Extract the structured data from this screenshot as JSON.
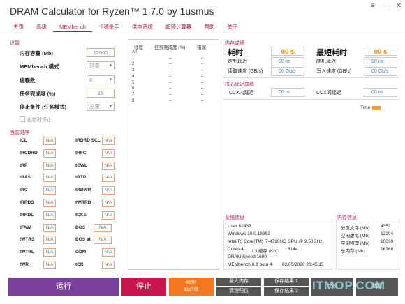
{
  "window": {
    "title": "DRAM Calculator for Ryzen™ 1.7.0 by 1usmus",
    "controls": [
      "≡",
      "—",
      "✕"
    ]
  },
  "tabs": [
    {
      "label": "主页",
      "active": false
    },
    {
      "label": "高级",
      "active": false
    },
    {
      "label": "MEMbench",
      "active": true
    },
    {
      "label": "卡顿杀手",
      "active": false
    },
    {
      "label": "供电系统",
      "active": false
    },
    {
      "label": "超频计算器",
      "active": false
    },
    {
      "label": "帮助",
      "active": false
    },
    {
      "label": "关于",
      "active": false
    }
  ],
  "settings": {
    "section_title": "设置",
    "memory_label": "内存容量 (Mb)",
    "memory_value": "12000",
    "mode_label": "MEMbench 模式",
    "mode_value": "轻量",
    "threads_label": "线程数",
    "threads_value": "8",
    "completion_label": "任务完成度 (%)",
    "completion_value": "15",
    "stop_label": "停止条件 (任务模式)",
    "stop_value": "总量",
    "stop_on_error_label": "出错时停止",
    "stop_on_error_checked": false
  },
  "timings": {
    "section_title": "当前时序",
    "left": [
      {
        "label": "tCL",
        "value": "N/A"
      },
      {
        "label": "tRCDRD",
        "value": "N/A"
      },
      {
        "label": "tRP",
        "value": "N/A"
      },
      {
        "label": "tRAS",
        "value": "N/A"
      },
      {
        "label": "tRC",
        "value": "N/A"
      },
      {
        "label": "tRRDS",
        "value": "N/A"
      },
      {
        "label": "tRRDL",
        "value": "N/A"
      },
      {
        "label": "tFAW",
        "value": "N/A"
      },
      {
        "label": "tWTRS",
        "value": "N/A"
      },
      {
        "label": "tWTRL",
        "value": "N/A"
      },
      {
        "label": "tWR",
        "value": "N/A"
      }
    ],
    "right": [
      {
        "label": "tRDRD SCL",
        "value": "N/A"
      },
      {
        "label": "tRFC",
        "value": "N/A"
      },
      {
        "label": "tCWL",
        "value": "N/A"
      },
      {
        "label": "tRTP",
        "value": "N/A"
      },
      {
        "label": "tRDWR",
        "value": "N/A"
      },
      {
        "label": "tWRRD",
        "value": "N/A"
      },
      {
        "label": "tCKE",
        "value": "N/A"
      },
      {
        "label": "BGS",
        "value": "N/A"
      },
      {
        "label": "BGS alt",
        "value": "N/A"
      },
      {
        "label": "GDM",
        "value": "N/A"
      },
      {
        "label": "tCR",
        "value": "N/A"
      }
    ]
  },
  "thread_table": {
    "headers": [
      "线程",
      "任务完成度 (%)",
      "错误"
    ],
    "rows": [
      [
        "All",
        "–",
        "–"
      ],
      [
        "1",
        "–",
        "–"
      ],
      [
        "2",
        "–",
        "–"
      ],
      [
        "3",
        "–",
        "–"
      ],
      [
        "4",
        "–",
        "–"
      ],
      [
        "5",
        "–",
        "–"
      ],
      [
        "6",
        "–",
        "–"
      ],
      [
        "7",
        "–",
        "–"
      ],
      [
        "8",
        "–",
        "–"
      ]
    ]
  },
  "results": {
    "section_title": "内存成绩",
    "elapsed_label": "耗时",
    "elapsed_value": "00 s",
    "fastest_label": "最短耗时",
    "fastest_value": "00 s",
    "seq_latency_label": "定制延迟",
    "seq_latency_value": "00 ns",
    "rand_latency_label": "随机延迟",
    "rand_latency_value": "00 ns",
    "read_label": "读取速度 (GB/s)",
    "read_value": "00 Gb/s",
    "write_label": "写入速度 (GB/s)",
    "write_value": "00 Gb/s"
  },
  "core_latency": {
    "section_title": "核心延迟成绩",
    "ccx_in_label": "CCX内延迟",
    "ccx_in_value": "00 ns",
    "ccx_between_label": "CCX间延迟",
    "ccx_between_value": "00 ns"
  },
  "time_legend": {
    "label": "Time",
    "color": "#f0a020"
  },
  "system_info": {
    "section_title": "系统信息",
    "user": "User 82439",
    "os": "Windows 10.0.18362",
    "cpu": "Intel(R) Core(TM) i7-4710HQ CPU @ 2.50GHz",
    "cores": "Cores 4",
    "l3_label": "L3 缓存 (Kb)",
    "l3_value": "6144",
    "dram_speed": "DRAM Speed 1600",
    "membench": "MEMbench 0.8 beta 4",
    "date": "02/05/2020 20:45:15"
  },
  "memory_info": {
    "section_title": "内存信息",
    "rows": [
      {
        "label": "分页文件 (Mb)",
        "value": "4352"
      },
      {
        "label": "空闲虚拟 (Mb)",
        "value": "12204"
      },
      {
        "label": "空闲物理 (Mb)",
        "value": "10030"
      },
      {
        "label": "总内存 (Mb)",
        "value": "16268"
      }
    ]
  },
  "bottom": {
    "run_label": "运行",
    "stop_label": "停止",
    "draw_latency_label1": "绘制",
    "draw_latency_label2": "延迟图",
    "max_memory_label": "最大内存",
    "clear_label": "清理归位",
    "save1_label": "保存结果 1",
    "save2_label": "保存结果 2",
    "export_label": "比较",
    "screenshot_label": "截图"
  },
  "watermark": "ITMOP.COM",
  "colors": {
    "accent": "#c2185b",
    "run_button": "#7b3f9e",
    "stop_button": "#c8174f",
    "draw_button": "#f47920",
    "orange_value": "#ff7f00",
    "blue_value": "#3a7fd0"
  }
}
